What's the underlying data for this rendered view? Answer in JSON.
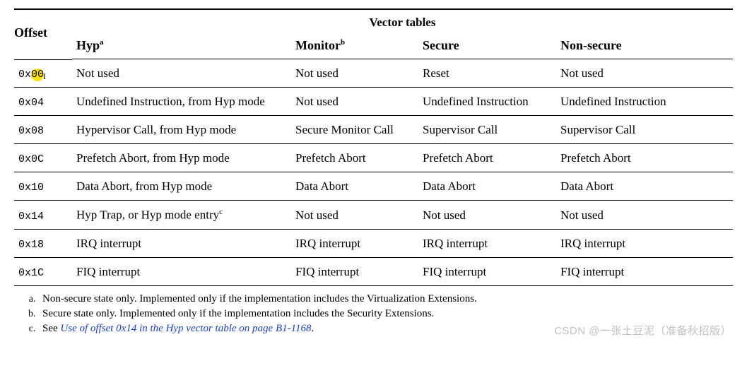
{
  "headers": {
    "offset": "Offset",
    "vector": "Vector tables",
    "cols": {
      "hyp": "Hyp",
      "hyp_fn": "a",
      "monitor": "Monitor",
      "monitor_fn": "b",
      "secure": "Secure",
      "nonsecure": "Non-secure"
    }
  },
  "rows": [
    {
      "offset": "0x00",
      "highlight": true,
      "hyp": "Not used",
      "mon": "Not used",
      "sec": "Reset",
      "non": "Not used"
    },
    {
      "offset": "0x04",
      "hyp": "Undefined Instruction, from Hyp mode",
      "mon": "Not used",
      "sec": "Undefined Instruction",
      "non": "Undefined Instruction"
    },
    {
      "offset": "0x08",
      "hyp": "Hypervisor Call, from Hyp mode",
      "mon": "Secure Monitor Call",
      "sec": "Supervisor Call",
      "non": "Supervisor Call"
    },
    {
      "offset": "0x0C",
      "hyp": "Prefetch Abort, from Hyp mode",
      "mon": "Prefetch Abort",
      "sec": "Prefetch Abort",
      "non": "Prefetch Abort"
    },
    {
      "offset": "0x10",
      "hyp": "Data Abort, from Hyp mode",
      "mon": "Data Abort",
      "sec": "Data Abort",
      "non": "Data Abort"
    },
    {
      "offset": "0x14",
      "hyp": "Hyp Trap, or Hyp mode entry",
      "hyp_fn": "c",
      "mon": "Not used",
      "sec": "Not used",
      "non": "Not used"
    },
    {
      "offset": "0x18",
      "hyp": "IRQ interrupt",
      "mon": "IRQ interrupt",
      "sec": "IRQ interrupt",
      "non": "IRQ interrupt"
    },
    {
      "offset": "0x1C",
      "hyp": "FIQ interrupt",
      "mon": "FIQ interrupt",
      "sec": "FIQ interrupt",
      "non": "FIQ interrupt"
    }
  ],
  "footnotes": {
    "a": "Non-secure state only. Implemented only if the implementation includes the Virtualization Extensions.",
    "b": "Secure state only. Implemented only if the implementation includes the Security Extensions.",
    "c_prefix": "See ",
    "c_link": "Use of offset 0x14 in the Hyp vector table",
    "c_mid": " on page B1-1168",
    "c_suffix": "."
  },
  "watermark": "CSDN @一张土豆泥（准备秋招版）"
}
